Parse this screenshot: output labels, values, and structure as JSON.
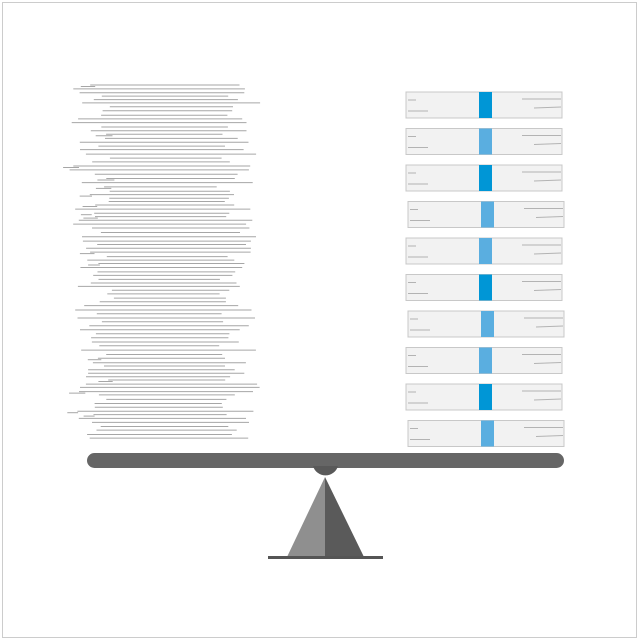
{
  "illustration": {
    "subject": "seesaw balance",
    "left_side": "stacked-paper-lines",
    "right_side": "stacked-document-boxes",
    "box_count": 10,
    "colors": {
      "background": "#ffffff",
      "frame": "#cccccc",
      "paper_line": "#a6a6a6",
      "box_fill": "#f2f2f2",
      "box_border": "#c8c8c8",
      "box_scribble": "#b3b3b3",
      "stripe_dark": "#0096d6",
      "stripe_light": "#5aaee0",
      "beam": "#666666",
      "pivot": "#595959",
      "fulcrum_light": "#8f8f8f",
      "fulcrum_dark": "#5a5a5a",
      "base": "#555555"
    },
    "stripe_pattern": [
      "dark",
      "light",
      "dark",
      "light",
      "light",
      "dark",
      "light",
      "light",
      "dark",
      "light"
    ]
  }
}
